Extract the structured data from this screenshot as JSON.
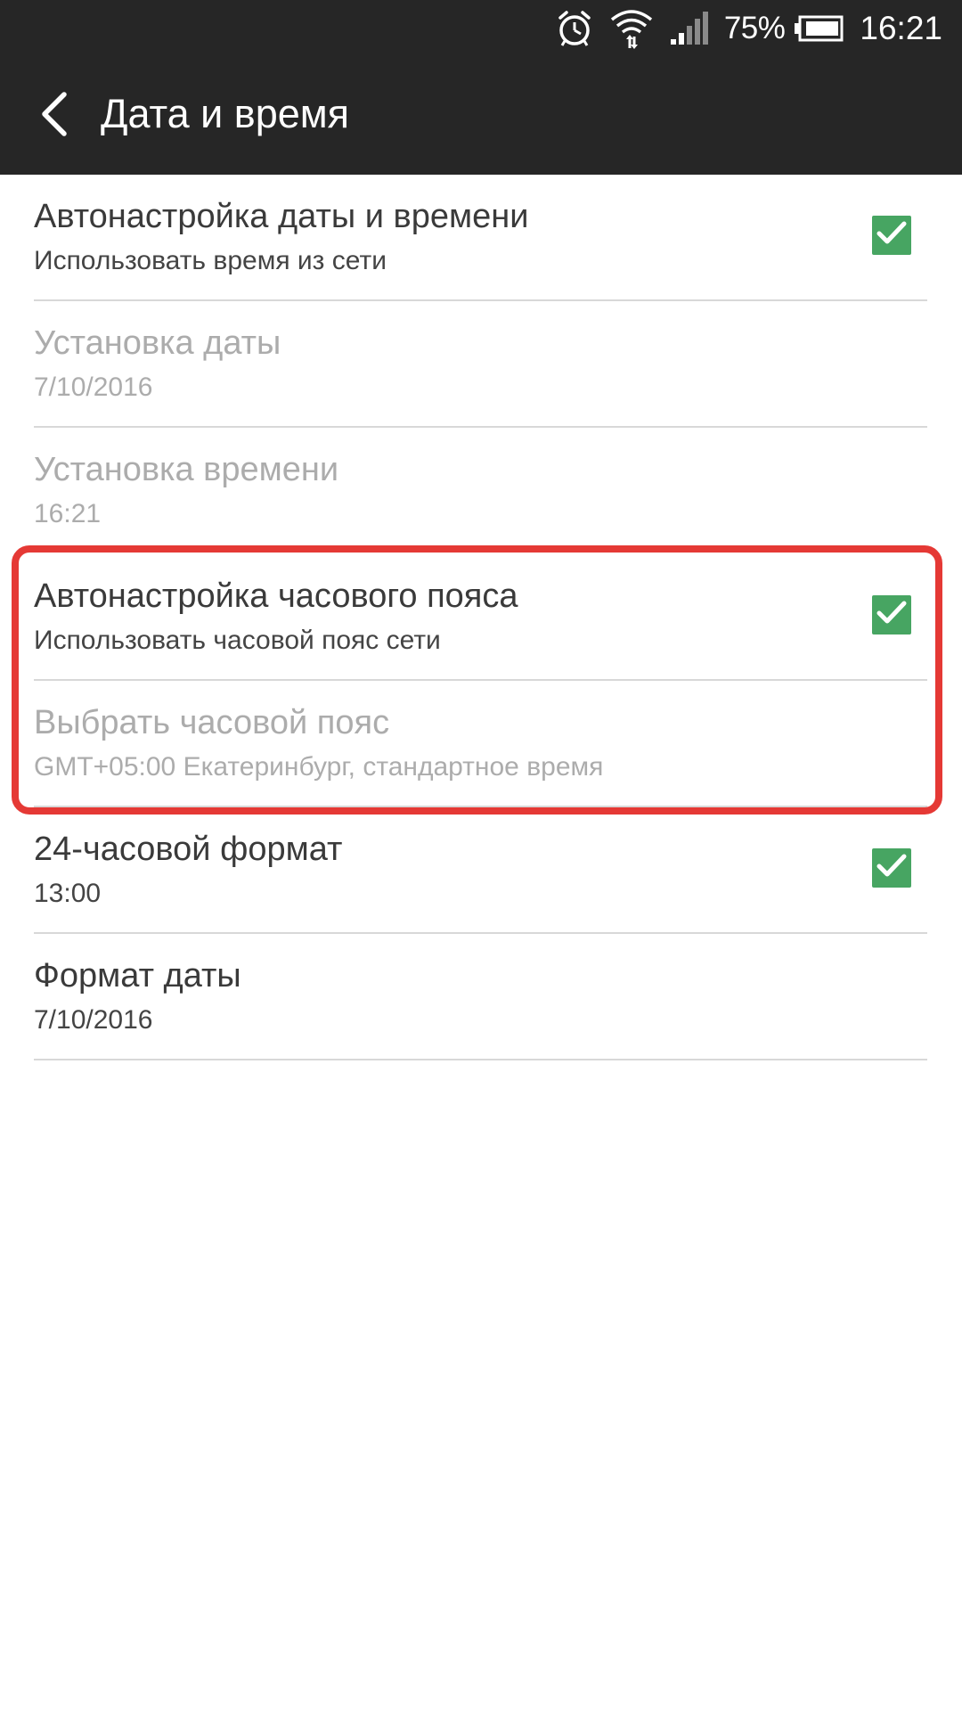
{
  "status_bar": {
    "icons": [
      "alarm-icon",
      "wifi-icon",
      "signal-icon",
      "battery-icon"
    ],
    "battery_percent": "75%",
    "time": "16:21"
  },
  "app_bar": {
    "back_icon": "back-arrow-icon",
    "title": "Дата и время"
  },
  "settings": {
    "items": [
      {
        "title": "Автонастройка даты и времени",
        "subtitle": "Использовать время из сети",
        "checked": true,
        "enabled": true
      },
      {
        "title": "Установка даты",
        "subtitle": "7/10/2016",
        "enabled": false
      },
      {
        "title": "Установка времени",
        "subtitle": "16:21",
        "enabled": false
      },
      {
        "title": "Автонастройка часового пояса",
        "subtitle": "Использовать часовой пояс сети",
        "checked": true,
        "enabled": true
      },
      {
        "title": "Выбрать часовой пояс",
        "subtitle": "GMT+05:00 Екатеринбург, стандартное время",
        "enabled": false
      },
      {
        "title": "24-часовой формат",
        "subtitle": "13:00",
        "checked": true,
        "enabled": true
      },
      {
        "title": "Формат даты",
        "subtitle": "7/10/2016",
        "enabled": true
      }
    ]
  },
  "colors": {
    "bar_background": "#262626",
    "checkbox_green": "#47a562",
    "highlight_red": "#e53935",
    "disabled_text": "#acacac"
  }
}
